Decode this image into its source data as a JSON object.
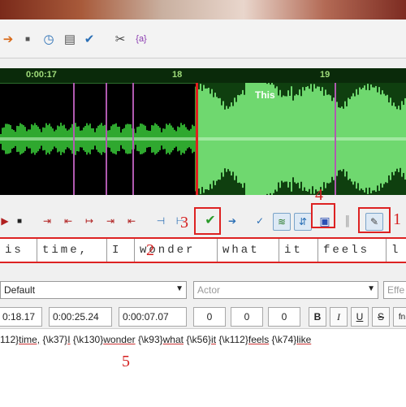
{
  "waveform": {
    "ruler": {
      "t1": "0:00:17",
      "t2": "18",
      "t3": "19"
    },
    "overlay_word": "This",
    "colors": {
      "audio": "#37c837",
      "selected_bg": "#0f3f0f",
      "cursor": "#e02020",
      "marker": "#b05ab0"
    }
  },
  "callouts": {
    "n1": "1",
    "n2": "2",
    "n3": "3",
    "n4": "4",
    "n5": "5"
  },
  "syllables": [
    "is",
    "time,",
    "I",
    "wonder",
    "what",
    "it",
    "feels",
    "l"
  ],
  "edit": {
    "style": "Default",
    "actor_placeholder": "Actor",
    "effect_placeholder": "Effe",
    "start_time": "0:18.17",
    "end_time": "0:00:25.24",
    "duration": "0:00:07.07",
    "margin_l": "0",
    "margin_r": "0",
    "margin_v": "0",
    "bold": "B",
    "italic": "I",
    "underline": "U",
    "strike": "S",
    "fontname": "fn"
  },
  "karaoke": [
    {
      "tag": "112}",
      "word": "time,"
    },
    {
      "tag": " {\\k37}",
      "word": "I"
    },
    {
      "tag": " {\\k130}",
      "word": "wonder"
    },
    {
      "tag": " {\\k93}",
      "word": "what"
    },
    {
      "tag": " {\\k56}",
      "word": "it"
    },
    {
      "tag": " {\\k112}",
      "word": "feels"
    },
    {
      "tag": " {\\k74}",
      "word": "like"
    }
  ]
}
